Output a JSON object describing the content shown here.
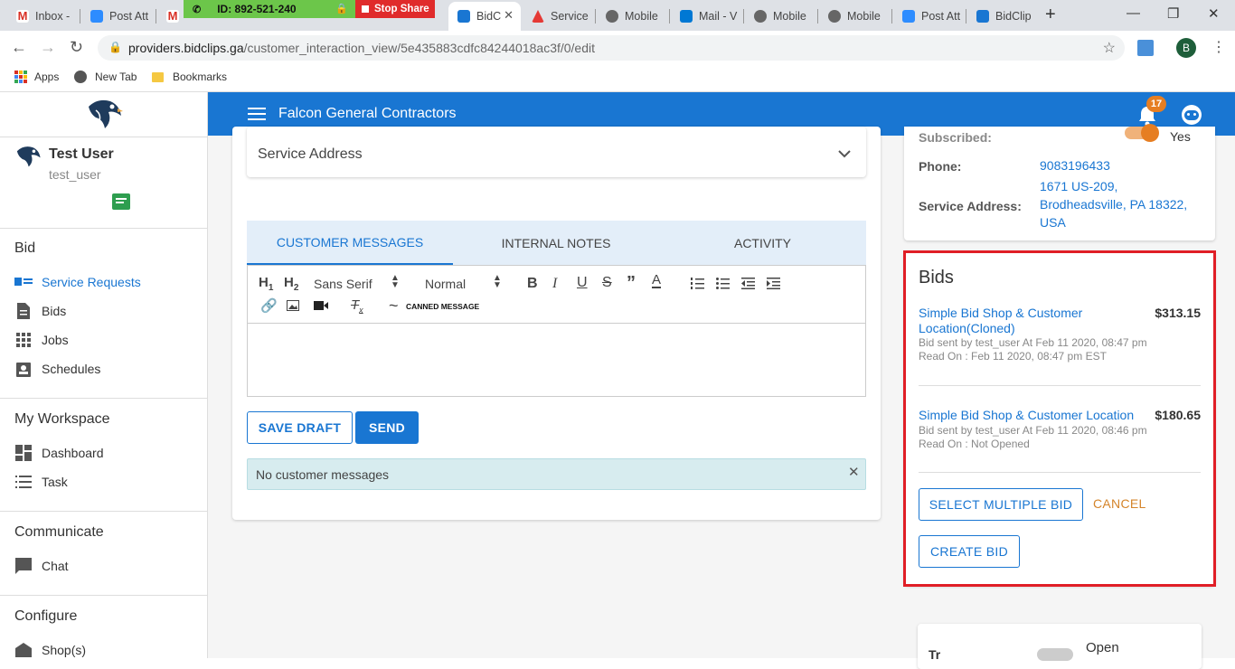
{
  "browser": {
    "tabs": [
      {
        "label": "Inbox -",
        "color": "#d93025"
      },
      {
        "label": "Post Att",
        "color": "#2d8cff"
      },
      {
        "label": "",
        "color": "#d93025"
      },
      {
        "label": "BidC",
        "color": "#1976d2"
      },
      {
        "label": "Service",
        "color": "#e53935"
      },
      {
        "label": "Mobile",
        "color": "#666666"
      },
      {
        "label": "Mail - V",
        "color": "#0078d4"
      },
      {
        "label": "Mobile",
        "color": "#666666"
      },
      {
        "label": "Mobile",
        "color": "#666666"
      },
      {
        "label": "Post Att",
        "color": "#2d8cff"
      },
      {
        "label": "BidClip",
        "color": "#1976d2"
      }
    ],
    "zoom_id": "ID: 892-521-240",
    "stop_share": "Stop Share",
    "url_host": "providers.bidclips.ga",
    "url_path": "/customer_interaction_view/5e435883cdfc84244018ac3f/0/edit",
    "profile_letter": "B",
    "bookmarks": [
      "Apps",
      "New Tab",
      "Bookmarks"
    ]
  },
  "sidebar": {
    "user_name": "Test User",
    "user_handle": "test_user",
    "sections": [
      {
        "title": "Bid",
        "items": [
          "Service Requests",
          "Bids",
          "Jobs",
          "Schedules"
        ]
      },
      {
        "title": "My Workspace",
        "items": [
          "Dashboard",
          "Task"
        ]
      },
      {
        "title": "Communicate",
        "items": [
          "Chat"
        ]
      },
      {
        "title": "Configure",
        "items": [
          "Shop(s)"
        ]
      }
    ]
  },
  "topbar": {
    "title": "Falcon General Contractors",
    "notification_count": "17"
  },
  "form": {
    "service_address_label": "Service Address"
  },
  "messages": {
    "tabs": [
      "CUSTOMER MESSAGES",
      "INTERNAL NOTES",
      "ACTIVITY"
    ],
    "font_family": "Sans Serif",
    "font_size": "Normal",
    "canned_message": "CANNED MESSAGE",
    "save_draft": "SAVE DRAFT",
    "send": "SEND",
    "empty_notice": "No customer messages"
  },
  "details": {
    "subscribed_label": "Subscribed:",
    "subscribed_value": "Yes",
    "phone_label": "Phone:",
    "phone_value": "9083196433",
    "address_label": "Service Address:",
    "address_value": "1671 US-209, Brodheadsville, PA 18322, USA"
  },
  "bids": {
    "title": "Bids",
    "items": [
      {
        "name": "Simple Bid Shop & Customer Location(Cloned)",
        "amount": "$313.15",
        "sent": "Bid sent by test_user At Feb 11 2020, 08:47 pm",
        "read": "Read On : Feb 11 2020, 08:47 pm EST"
      },
      {
        "name": "Simple Bid Shop & Customer Location",
        "amount": "$180.65",
        "sent": "Bid sent by test_user At Feb 11 2020, 08:46 pm",
        "read": "Read On : Not Opened"
      }
    ],
    "select_multiple": "SELECT MULTIPLE BID",
    "cancel": "CANCEL",
    "create": "CREATE BID",
    "highlight_color": "#e01e26"
  },
  "bottom_card": {
    "status_label": "Tr",
    "status_value": "Open"
  }
}
